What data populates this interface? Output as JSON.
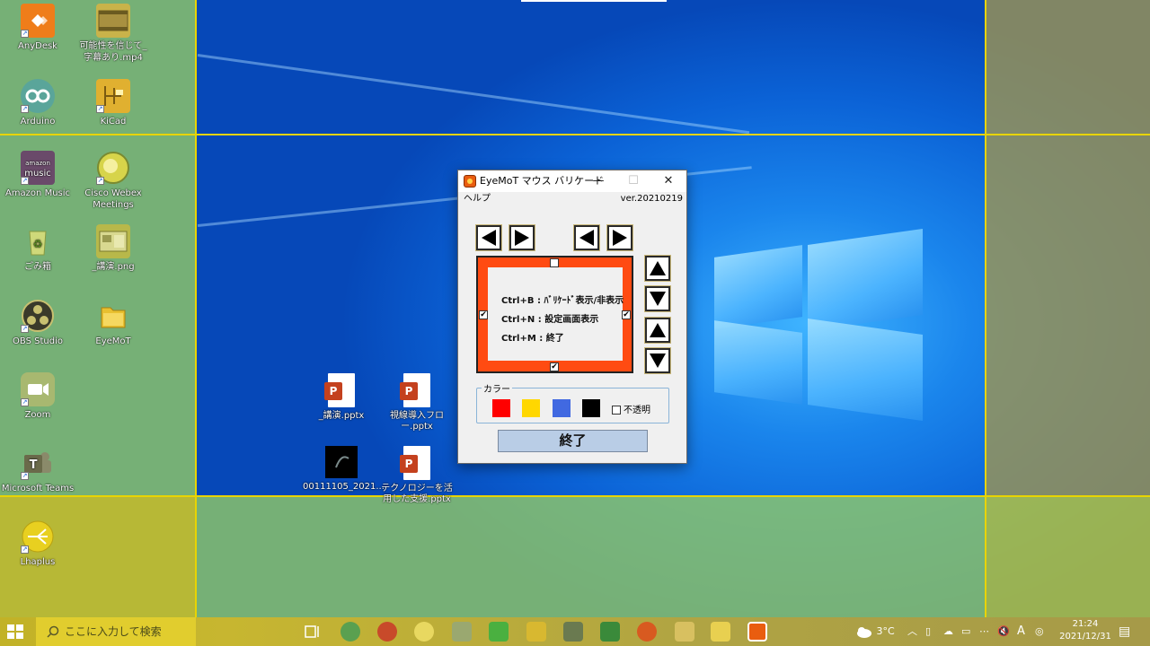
{
  "desktop": {
    "icons": [
      {
        "label": "AnyDesk",
        "icon": "anydesk-icon",
        "color": "#ef7d1a"
      },
      {
        "label": "可能性を信じて_字幕あり.mp4",
        "icon": "video-file-icon",
        "color": "#c9b34a"
      },
      {
        "label": "Arduino",
        "icon": "arduino-icon",
        "color": "#5aa59a"
      },
      {
        "label": "KiCad",
        "icon": "kicad-icon",
        "color": "#e0b030"
      },
      {
        "label": "Amazon Music",
        "icon": "amazon-music-icon",
        "color": "#6a4a6a"
      },
      {
        "label": "Cisco Webex Meetings",
        "icon": "webex-icon",
        "color": "#d7d44a"
      },
      {
        "label": "ごみ箱",
        "icon": "recycle-bin-icon",
        "color": "#b8c85a"
      },
      {
        "label": "_講演.png",
        "icon": "image-file-icon",
        "color": "#b8b84a"
      },
      {
        "label": "OBS Studio",
        "icon": "obs-icon",
        "color": "#3a3a2a"
      },
      {
        "label": "EyeMoT",
        "icon": "folder-icon",
        "color": "#e8c030"
      },
      {
        "label": "Zoom",
        "icon": "zoom-icon",
        "color": "#a8b870"
      },
      {
        "label": "Microsoft Teams",
        "icon": "teams-icon",
        "color": "#8a8a6a"
      },
      {
        "label": "Lhaplus",
        "icon": "lhaplus-icon",
        "color": "#e0c020"
      }
    ],
    "files": [
      {
        "label": "_講演.pptx",
        "type": "pptx"
      },
      {
        "label": "視線導入フロー.pptx",
        "type": "pptx"
      },
      {
        "label": "00111105_2021...",
        "type": "video"
      },
      {
        "label": "テクノロジーを活用した支援.pptx",
        "type": "pptx"
      }
    ]
  },
  "window": {
    "title": "EyeMoT マウス バリケード",
    "minimize": "—",
    "maximize": "☐",
    "close": "✕",
    "menu_help": "ヘルプ",
    "version": "ver.20210219",
    "hotkeys": [
      "Ctrl+B : ﾊﾞﾘｹｰﾄﾞ表示/非表示",
      "Ctrl+N : 設定画面表示",
      "Ctrl+M : 終了"
    ],
    "checkbox_top": "",
    "checkbox_left": "✔",
    "checkbox_right": "✔",
    "checkbox_bottom": "✔",
    "color_label": "カラー",
    "swatches": [
      "#ff0000",
      "#ffd700",
      "#4169e1",
      "#000000"
    ],
    "opaque_label": "不透明",
    "opaque_checked": "",
    "exit_label": "終了",
    "panel_color": "#ff4b12"
  },
  "taskbar": {
    "search_placeholder": "ここに入力して検索",
    "weather": "3°C",
    "ime": "A",
    "time": "21:24",
    "date": "2021/12/31"
  }
}
